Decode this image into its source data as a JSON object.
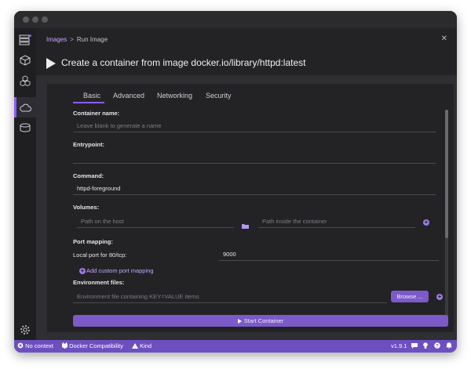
{
  "breadcrumb": {
    "link": "Images",
    "separator": ">",
    "current": "Run Image"
  },
  "page_title": "Create a container from image docker.io/library/httpd:latest",
  "tabs": [
    {
      "label": "Basic",
      "active": true
    },
    {
      "label": "Advanced",
      "active": false
    },
    {
      "label": "Networking",
      "active": false
    },
    {
      "label": "Security",
      "active": false
    }
  ],
  "form": {
    "container_name": {
      "label": "Container name:",
      "value": "",
      "placeholder": "Leave blank to generate a name"
    },
    "entrypoint": {
      "label": "Entrypoint:",
      "value": ""
    },
    "command": {
      "label": "Command:",
      "value": "httpd-foreground"
    },
    "volumes": {
      "label": "Volumes:",
      "host_placeholder": "Path on the host",
      "container_placeholder": "Path inside the container"
    },
    "port_mapping": {
      "label": "Port mapping:",
      "local_port_label": "Local port for 80/tcp:",
      "local_port_value": "9000",
      "add_label": "Add custom port mapping"
    },
    "env_files": {
      "label": "Environment files:",
      "placeholder": "Environment file containing KEY=VALUE items",
      "browse_label": "Browse ..."
    }
  },
  "start_button": "Start Container",
  "statusbar": {
    "context": "No context",
    "compat": "Docker Compatibility",
    "kind": "Kind",
    "version": "v1.9.1"
  },
  "colors": {
    "accent": "#8b5cf6",
    "button": "#7c5ac9",
    "statusbar": "#6d4fc0",
    "link": "#c3a6ff"
  },
  "icons": [
    "dashboard-icon",
    "container-icon",
    "pods-icon",
    "images-icon",
    "volumes-icon",
    "settings-icon",
    "folder-icon",
    "plus-circle-icon",
    "close-icon",
    "play-icon",
    "bell-icon"
  ]
}
